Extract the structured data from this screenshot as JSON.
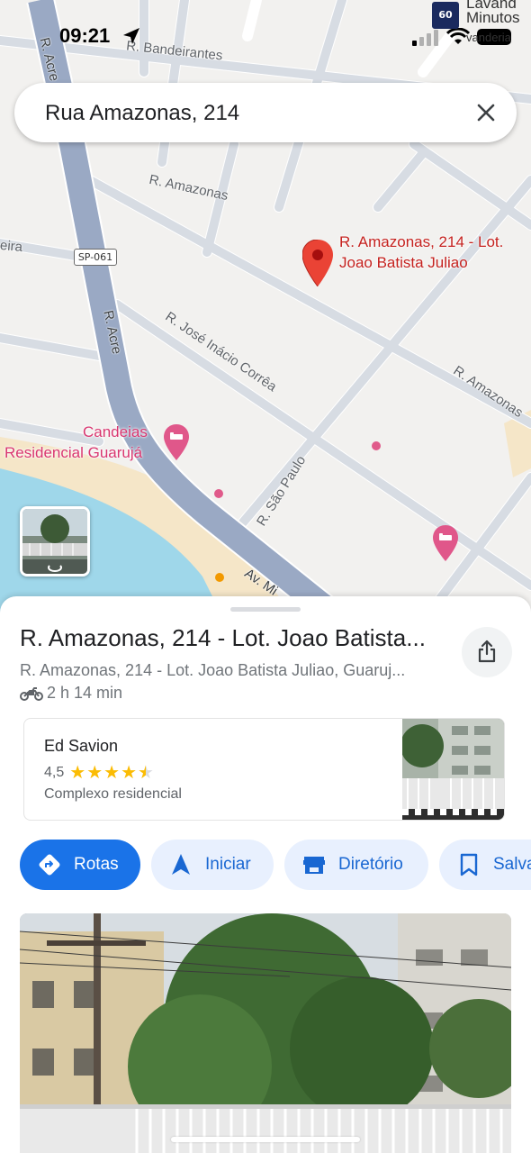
{
  "status_bar": {
    "time": "09:21"
  },
  "ad_banner": {
    "badge": "60",
    "line1": "Lavand",
    "line2": "Minutos",
    "line3": "vanderia"
  },
  "search": {
    "query": "Rua Amazonas, 214"
  },
  "map": {
    "streets": {
      "acre_top": "R. Acre",
      "bandeirantes": "R. Bandeirantes",
      "amazonas_1": "R. Amazonas",
      "eira": "eira",
      "acre_mid": "R. Acre",
      "jose_inacio": "R. José Inácio Corrêa",
      "amazonas_2": "R. Amazonas",
      "sao_paulo": "R. São Paulo",
      "av_mi": "Av. Mi"
    },
    "highway_shield": "SP-061",
    "pin_label": "R. Amazonas, 214 - Lot. Joao Batista Juliao",
    "poi": {
      "line1": "Candeias",
      "line2": "Residencial Guarujá"
    }
  },
  "place": {
    "title": "R. Amazonas, 214 - Lot. Joao Batista...",
    "address": "R. Amazonas, 214 - Lot. Joao Batista Juliao, Guaruj...",
    "travel_time": "2 h 14 min",
    "travel_mode_icon": "motorcycle-icon"
  },
  "nearby_card": {
    "name": "Ed Savion",
    "rating": "4,5",
    "stars": 4.5,
    "type": "Complexo residencial"
  },
  "actions": [
    {
      "label": "Rotas",
      "icon": "directions-icon"
    },
    {
      "label": "Iniciar",
      "icon": "navigation-arrow-icon"
    },
    {
      "label": "Diretório",
      "icon": "storefront-icon"
    },
    {
      "label": "Salva",
      "icon": "bookmark-icon"
    }
  ],
  "colors": {
    "accent": "#1a73e8",
    "chip_bg": "#e8f0fe",
    "pin": "#ea4335",
    "poi": "#d93670",
    "water": "#9fd7ea",
    "sand": "#f5e6c8"
  }
}
